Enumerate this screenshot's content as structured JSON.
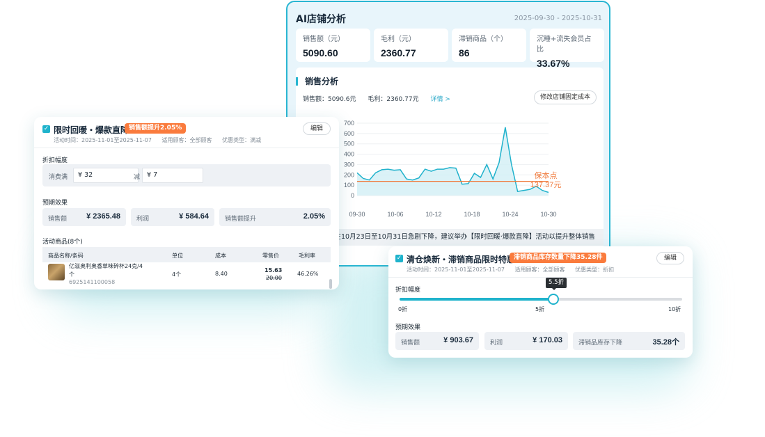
{
  "ai": {
    "title": "AI店铺分析",
    "date_range": "2025-09-30 - 2025-10-31",
    "kpis": [
      {
        "label": "销售额（元）",
        "value": "5090.60"
      },
      {
        "label": "毛利（元）",
        "value": "2360.77"
      },
      {
        "label": "滞销商品（个）",
        "value": "86"
      },
      {
        "label": "沉睡+流失会员占比",
        "value": "33.67%"
      }
    ],
    "sales": {
      "title": "销售分析",
      "sales_label": "销售额：5090.6元",
      "profit_label": "毛利：2360.77元",
      "detail_link": "详情 >",
      "fix_cost_button": "修改店铺固定成本",
      "advice": "额在10月23日至10月31日急剧下降，建议举办【限时回暖·爆款直降】活动以提升整体销售"
    },
    "colors": {
      "line": "#20b2cc",
      "area": "#d2eff5",
      "break_even": "#f07a3c"
    }
  },
  "chart_data": {
    "type": "area",
    "x_tick_labels": [
      "09-30",
      "10-06",
      "10-12",
      "10-18",
      "10-24",
      "10-30"
    ],
    "ylim": [
      0,
      700
    ],
    "y_ticks": [
      0,
      100,
      200,
      300,
      400,
      500,
      600,
      700
    ],
    "values": [
      220,
      165,
      150,
      220,
      250,
      255,
      245,
      250,
      160,
      150,
      170,
      255,
      235,
      255,
      255,
      270,
      265,
      110,
      115,
      215,
      175,
      300,
      160,
      320,
      660,
      300,
      40,
      50,
      60,
      90,
      50,
      30
    ],
    "break_even": {
      "value": 137.37,
      "label_title": "保本点",
      "label_value": "137.37元"
    },
    "grid": true,
    "legend": "none"
  },
  "card1": {
    "title": "限时回暖・爆款直降",
    "badge": "销售额提升2.05%",
    "time": "活动时间：2025-11-01至2025-11-07",
    "customers": "适用顾客：全部顾客",
    "promo_type": "优惠类型：满减",
    "edit": "编辑",
    "discount_title": "折扣幅度",
    "spend_label": "消费满",
    "spend_value": "¥  32",
    "minus_label": "减",
    "minus_value": "¥  7",
    "effect_title": "预期效果",
    "effects": [
      {
        "label": "销售额",
        "value": "¥ 2365.48"
      },
      {
        "label": "利润",
        "value": "¥ 584.64"
      },
      {
        "label": "销售额提升",
        "value": "2.05%"
      }
    ],
    "goods_title": "活动商品(8个)",
    "columns": [
      "商品名称/条码",
      "单位",
      "成本",
      "零售价",
      "毛利率"
    ],
    "row": {
      "name_line1": "亿滋奥利奥香草味碎杯24克/4",
      "name_line2": "个",
      "barcode": "6925141100058",
      "unit": "4个",
      "cost": "8.40",
      "price": "15.63",
      "old_price": "20.00",
      "margin": "46.26%"
    }
  },
  "card2": {
    "title": "清仓焕新・滞销商品限时特惠",
    "badge": "滞销商品库存数量下降35.28件",
    "time": "活动时间：2025-11-01至2025-11-07",
    "customers": "适用顾客：全部顾客",
    "promo_type": "优惠类型：折扣",
    "edit": "编辑",
    "discount_title": "折扣幅度",
    "slider_tooltip": "5.5折",
    "slider_value": 0.55,
    "ticks": [
      "0折",
      "5折",
      "10折"
    ],
    "effect_title": "预期效果",
    "effects": [
      {
        "label": "销售额",
        "value": "¥ 903.67"
      },
      {
        "label": "利润",
        "value": "¥ 170.03"
      },
      {
        "label": "滞销品库存下降",
        "value": "35.28个"
      }
    ]
  }
}
